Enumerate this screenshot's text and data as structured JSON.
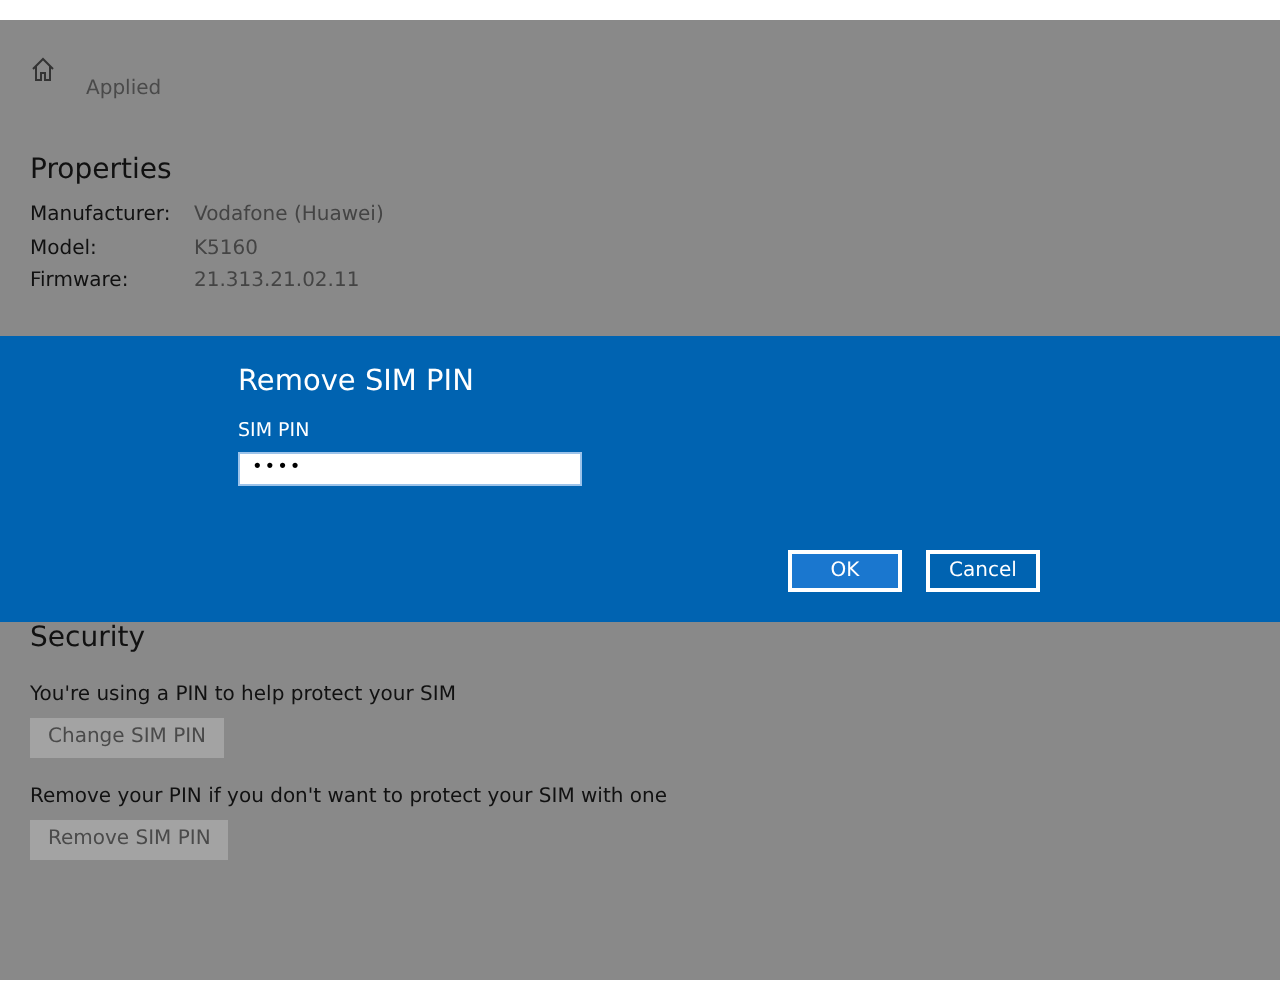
{
  "page": {
    "status_text": "Applied"
  },
  "properties": {
    "title": "Properties",
    "rows": [
      {
        "label": "Manufacturer:",
        "value": "Vodafone (Huawei)"
      },
      {
        "label": "Model:",
        "value": "K5160"
      },
      {
        "label": "Firmware:",
        "value": "21.313.21.02.11"
      }
    ]
  },
  "dialog": {
    "title": "Remove SIM PIN",
    "field_label": "SIM PIN",
    "field_value": "••••",
    "buttons": [
      {
        "label": "OK",
        "kind": "primary"
      },
      {
        "label": "Cancel",
        "kind": "secondary"
      }
    ]
  },
  "security": {
    "title": "Security",
    "items": [
      {
        "text": "You're using a PIN to help protect your SIM",
        "button": "Change SIM PIN",
        "disabled": true
      },
      {
        "text": "Remove your PIN if you don't want to protect your SIM with one",
        "button": "Remove SIM PIN",
        "disabled": true
      }
    ]
  }
}
